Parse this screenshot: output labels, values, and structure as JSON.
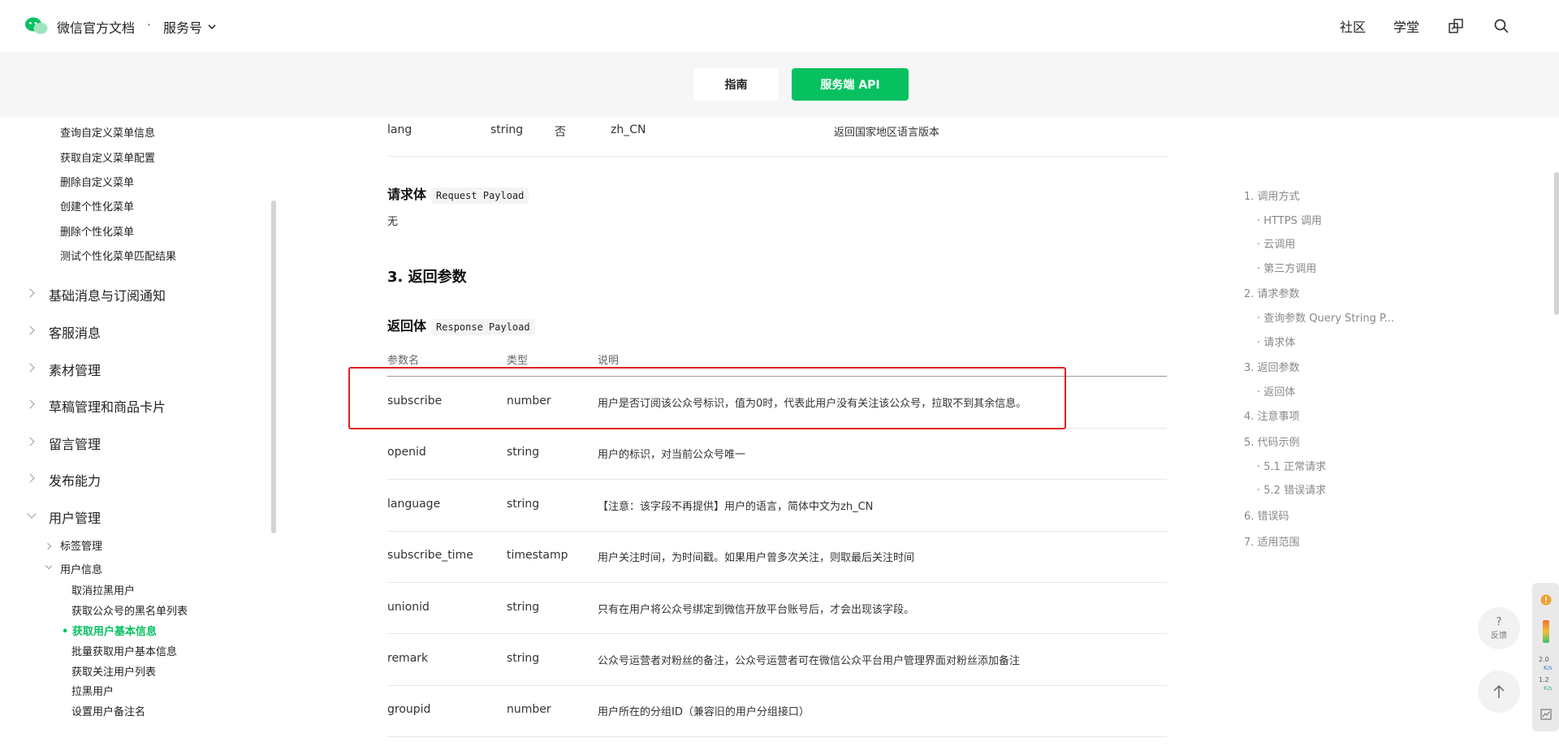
{
  "header": {
    "brand": "微信官方文档",
    "separator": "·",
    "product": "服务号",
    "nav": [
      "社区",
      "学堂"
    ],
    "icons": [
      "wechat-logo-icon",
      "chevron-down-icon",
      "share-icon",
      "search-icon"
    ]
  },
  "tabs": {
    "guide": "指南",
    "api": "服务端 API"
  },
  "sidebar": {
    "items_top": [
      "查询自定义菜单信息",
      "获取自定义菜单配置",
      "删除自定义菜单",
      "创建个性化菜单",
      "删除个性化菜单",
      "测试个性化菜单匹配结果"
    ],
    "groups": [
      "基础消息与订阅通知",
      "客服消息",
      "素材管理",
      "草稿管理和商品卡片",
      "留言管理",
      "发布能力",
      "用户管理"
    ],
    "sub_groups": [
      "标签管理",
      "用户信息"
    ],
    "user_info_items": [
      "取消拉黑用户",
      "获取公众号的黑名单列表",
      "获取用户基本信息",
      "批量获取用户基本信息",
      "获取关注用户列表",
      "拉黑用户",
      "设置用户备注名"
    ],
    "active_item": "获取用户基本信息"
  },
  "content": {
    "lang_row": {
      "name": "lang",
      "type": "string",
      "required": "否",
      "example": "zh_CN",
      "desc": "返回国家地区语言版本"
    },
    "request_body_title": "请求体",
    "request_body_code": "Request Payload",
    "request_body_value": "无",
    "section3": "3. 返回参数",
    "response_title": "返回体",
    "response_code": "Response Payload",
    "columns": [
      "参数名",
      "类型",
      "说明"
    ],
    "rows": [
      {
        "name": "subscribe",
        "type": "number",
        "desc": "用户是否订阅该公众号标识，值为0时，代表此用户没有关注该公众号，拉取不到其余信息。"
      },
      {
        "name": "openid",
        "type": "string",
        "desc": "用户的标识，对当前公众号唯一"
      },
      {
        "name": "language",
        "type": "string",
        "desc": "【注意：该字段不再提供】用户的语言，简体中文为zh_CN"
      },
      {
        "name": "subscribe_time",
        "type": "timestamp",
        "desc": "用户关注时间，为时间戳。如果用户曾多次关注，则取最后关注时间"
      },
      {
        "name": "unionid",
        "type": "string",
        "desc": "只有在用户将公众号绑定到微信开放平台账号后，才会出现该字段。"
      },
      {
        "name": "remark",
        "type": "string",
        "desc": "公众号运营者对粉丝的备注，公众号运营者可在微信公众平台用户管理界面对粉丝添加备注"
      },
      {
        "name": "groupid",
        "type": "number",
        "desc": "用户所在的分组ID（兼容旧的用户分组接口）"
      }
    ]
  },
  "toc": [
    {
      "label": "1. 调用方式",
      "level": 1
    },
    {
      "label": "· HTTPS 调用",
      "level": 2
    },
    {
      "label": "· 云调用",
      "level": 2
    },
    {
      "label": "· 第三方调用",
      "level": 2
    },
    {
      "label": "2. 请求参数",
      "level": 1
    },
    {
      "label": "· 查询参数 Query String P...",
      "level": 2
    },
    {
      "label": "· 请求体",
      "level": 2
    },
    {
      "label": "3. 返回参数",
      "level": 1
    },
    {
      "label": "· 返回体",
      "level": 2
    },
    {
      "label": "4. 注意事项",
      "level": 1
    },
    {
      "label": "5. 代码示例",
      "level": 1
    },
    {
      "label": "· 5.1 正常请求",
      "level": 2
    },
    {
      "label": "· 5.2 错误请求",
      "level": 2
    },
    {
      "label": "6. 错误码",
      "level": 1
    },
    {
      "label": "7. 适用范围",
      "level": 1
    }
  ],
  "floating": {
    "feedback_mark": "?",
    "feedback_label": "反馈",
    "widget_values": [
      "2.0",
      "K/s",
      "1.2",
      "K/s"
    ]
  },
  "colors": {
    "accent": "#07c160",
    "highlight": "#e02020"
  }
}
